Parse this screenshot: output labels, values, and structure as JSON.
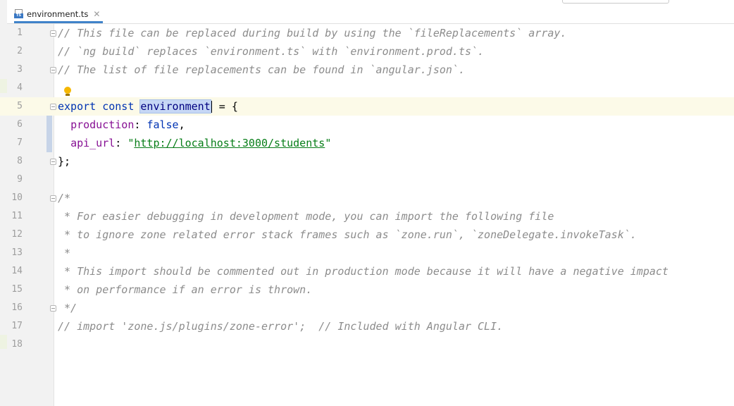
{
  "tab": {
    "filename": "environment.ts",
    "close_glyph": "✕"
  },
  "editor": {
    "line_numbers": [
      "1",
      "2",
      "3",
      "4",
      "5",
      "6",
      "7",
      "8",
      "9",
      "10",
      "11",
      "12",
      "13",
      "14",
      "15",
      "16",
      "17",
      "18"
    ],
    "lines": {
      "l1": "// This file can be replaced during build by using the `fileReplacements` array.",
      "l2": "// `ng build` replaces `environment.ts` with `environment.prod.ts`.",
      "l3": "// The list of file replacements can be found in `angular.json`.",
      "l5": {
        "kw": "export const",
        "ident": "environment",
        "rest": " = {"
      },
      "l6": {
        "prop": "production",
        "colon": ": ",
        "kw": "false",
        "comma": ","
      },
      "l7": {
        "prop": "api_url",
        "colon": ": ",
        "q1": "\"",
        "url": "http://localhost:3000/students",
        "q2": "\""
      },
      "l8": "};",
      "l10": "/*",
      "l11": " * For easier debugging in development mode, you can import the following file",
      "l12": " * to ignore zone related error stack frames such as `zone.run`, `zoneDelegate.invokeTask`.",
      "l13": " *",
      "l14": " * This import should be commented out in production mode because it will have a negative impact",
      "l15": " * on performance if an error is thrown.",
      "l16": " */",
      "l17": "// import 'zone.js/plugins/zone-error';  // Included with Angular CLI."
    },
    "caret_line": "5",
    "colors": {
      "keyword": "#0033b3",
      "comment": "#8c8c8c",
      "property": "#871094",
      "string": "#067d17",
      "caret_row": "#fcfae8"
    },
    "icons": {
      "file_type": "typescript-file-icon",
      "intention": "lightbulb-icon"
    }
  }
}
